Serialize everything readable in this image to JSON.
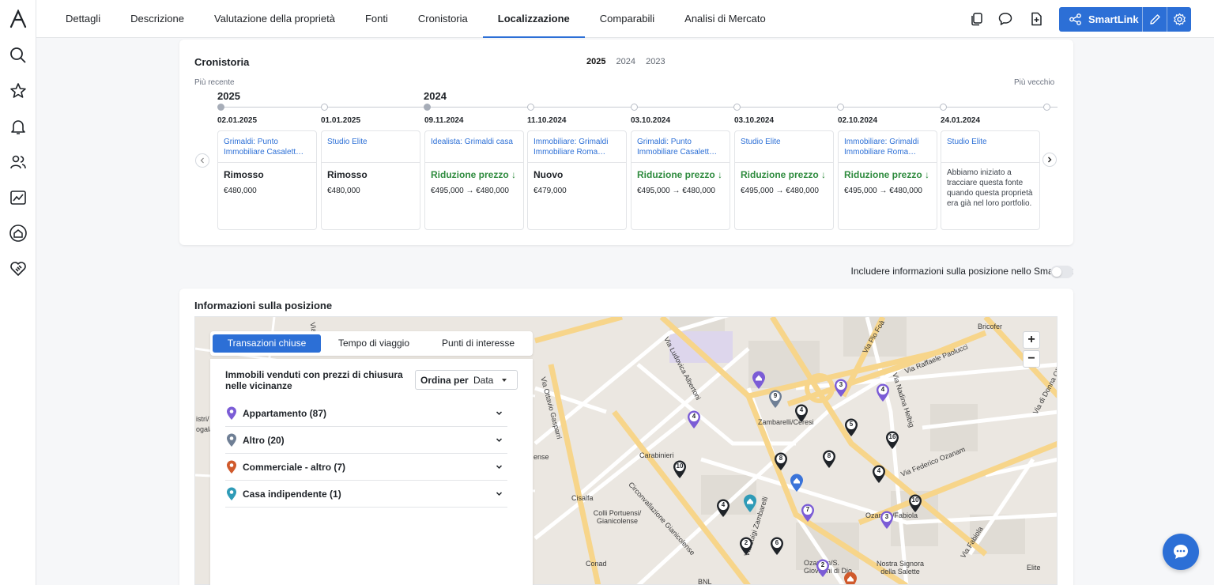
{
  "tabs": [
    "Dettagli",
    "Descrizione",
    "Valutazione della proprietà",
    "Fonti",
    "Cronistoria",
    "Localizzazione",
    "Comparabili",
    "Analisi di Mercato"
  ],
  "active_tab": "Localizzazione",
  "smartlink_label": "SmartLink",
  "timeline": {
    "title": "Cronistoria",
    "years": [
      "2025",
      "2024",
      "2023"
    ],
    "recent_label": "Più recente",
    "old_label": "Più vecchio",
    "year_markers": [
      "2025",
      "2024"
    ],
    "events": [
      {
        "date": "02.01.2025",
        "source": "Grimaldi: Punto Immobiliare Casalett…",
        "status": "Rimosso",
        "price": "€480,000"
      },
      {
        "date": "01.01.2025",
        "source": "Studio Elite",
        "status": "Rimosso",
        "price": "€480,000"
      },
      {
        "date": "09.11.2024",
        "source": "Idealista: Grimaldi casa",
        "status": "Riduzione prezzo ↓",
        "price": "€495,000 → €480,000"
      },
      {
        "date": "11.10.2024",
        "source": "Immobiliare: Grimaldi Immobiliare Roma…",
        "status": "Nuovo",
        "price": "€479,000"
      },
      {
        "date": "03.10.2024",
        "source": "Grimaldi: Punto Immobiliare Casalett…",
        "status": "Riduzione prezzo ↓",
        "price": "€495,000 → €480,000"
      },
      {
        "date": "03.10.2024",
        "source": "Studio Elite",
        "status": "Riduzione prezzo ↓",
        "price": "€495,000 → €480,000"
      },
      {
        "date": "02.10.2024",
        "source": "Immobiliare: Grimaldi Immobiliare Roma…",
        "status": "Riduzione prezzo ↓",
        "price": "€495,000 → €480,000"
      },
      {
        "date": "24.01.2024",
        "source": "Studio Elite",
        "note": "Abbiamo iniziato a tracciare questa fonte quando questa proprietà era già nel loro portfolio."
      }
    ]
  },
  "smartlink_toggle_label": "Includere informazioni sulla posizione nello Smartlink",
  "location": {
    "title": "Informazioni sulla posizione",
    "map_tabs": [
      "Transazioni chiuse",
      "Tempo di viaggio",
      "Punti di interesse"
    ],
    "panel_desc": "Immobili venduti con prezzi di chiusura nelle vicinanze",
    "sort_label": "Ordina per",
    "sort_value": "Data",
    "categories": [
      {
        "name": "Appartamento (87)",
        "color": "#7b5cd6"
      },
      {
        "name": "Altro (20)",
        "color": "#6f7f95"
      },
      {
        "name": "Commerciale - altro (7)",
        "color": "#d05a2c"
      },
      {
        "name": "Casa indipendente (1)",
        "color": "#2f9bb7"
      }
    ],
    "zoom_in": "+",
    "zoom_out": "−",
    "map_labels": [
      "Via Ludovica Albertoni",
      "Via Ottavio Gasparri",
      "Via Luigi Zambarelli",
      "Circonvallazione Gianicolense",
      "Via Federico Ozanam",
      "Via Raffaele Paolucci",
      "Via Nadina Helbig",
      "Via Pio Foà",
      "Via Fabiola",
      "Via di Donna Olimpia",
      "Carabinieri",
      "Cisalfa",
      "Colli Portuensi/ Gianicolense",
      "Conad",
      "Zambarelli/Ceresi",
      "Ozaman/Fabiola",
      "Ozanam/S. Giovanni di Dio",
      "Nostra Signora della Salette",
      "Elite",
      "Bricofer",
      "BNL",
      "Via",
      "istri/",
      "ogala",
      "ense"
    ]
  },
  "pins": [
    "4",
    "9",
    "4",
    "3",
    "4",
    "5",
    "16",
    "8",
    "8",
    "4",
    "10",
    "4",
    "7",
    "3",
    "10",
    "2",
    "6",
    "2"
  ]
}
